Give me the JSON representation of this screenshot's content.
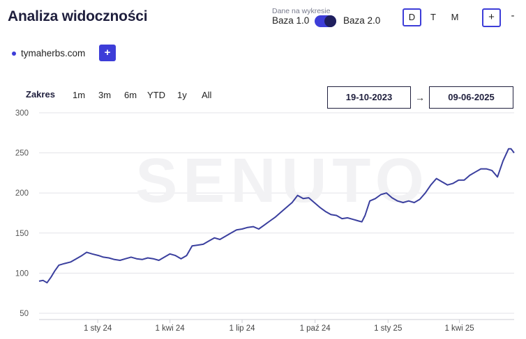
{
  "header": {
    "title": "Analiza widoczności"
  },
  "data_toggle": {
    "caption": "Dane na wykresie",
    "left_label": "Baza 1.0",
    "right_label": "Baza 2.0"
  },
  "granularity": {
    "options": [
      "D",
      "T",
      "M"
    ],
    "active": "D"
  },
  "zoom": {
    "in_label": "+",
    "out_label": "-"
  },
  "domain": {
    "name": "tymaherbs.com",
    "add_label": "+"
  },
  "range": {
    "label": "Zakres",
    "options": [
      "1m",
      "3m",
      "6m",
      "YTD",
      "1y",
      "All"
    ],
    "date_from": "19-10-2023",
    "arrow": "→",
    "date_to": "09-06-2025"
  },
  "watermark": "SENUTO",
  "colors": {
    "accent": "#3d3dd8",
    "line": "#3a3f9e",
    "text_dark": "#1f1f3d"
  },
  "chart_data": {
    "type": "line",
    "title": "",
    "xlabel": "",
    "ylabel": "",
    "ylim": [
      50,
      300
    ],
    "yticks": [
      50,
      100,
      150,
      200,
      250,
      300
    ],
    "xlim": [
      "2023-10-19",
      "2025-06-09"
    ],
    "xticks": [
      {
        "date": "2024-01-01",
        "label": "1 sty 24"
      },
      {
        "date": "2024-04-01",
        "label": "1 kwi 24"
      },
      {
        "date": "2024-07-01",
        "label": "1 lip 24"
      },
      {
        "date": "2024-10-01",
        "label": "1 paź 24"
      },
      {
        "date": "2025-01-01",
        "label": "1 sty 25"
      },
      {
        "date": "2025-04-01",
        "label": "1 kwi 25"
      }
    ],
    "grid": "horizontal",
    "series": [
      {
        "values": [
          [
            "2023-10-19",
            90
          ],
          [
            "2023-10-24",
            91
          ],
          [
            "2023-10-29",
            88
          ],
          [
            "2023-11-03",
            95
          ],
          [
            "2023-11-08",
            103
          ],
          [
            "2023-11-13",
            110
          ],
          [
            "2023-11-20",
            112
          ],
          [
            "2023-11-28",
            114
          ],
          [
            "2023-12-05",
            118
          ],
          [
            "2023-12-12",
            122
          ],
          [
            "2023-12-18",
            126
          ],
          [
            "2023-12-25",
            124
          ],
          [
            "2024-01-02",
            122
          ],
          [
            "2024-01-08",
            120
          ],
          [
            "2024-01-15",
            119
          ],
          [
            "2024-01-22",
            117
          ],
          [
            "2024-01-29",
            116
          ],
          [
            "2024-02-05",
            118
          ],
          [
            "2024-02-12",
            120
          ],
          [
            "2024-02-19",
            118
          ],
          [
            "2024-02-26",
            117
          ],
          [
            "2024-03-04",
            119
          ],
          [
            "2024-03-11",
            118
          ],
          [
            "2024-03-18",
            116
          ],
          [
            "2024-03-25",
            120
          ],
          [
            "2024-04-01",
            124
          ],
          [
            "2024-04-08",
            122
          ],
          [
            "2024-04-15",
            118
          ],
          [
            "2024-04-22",
            122
          ],
          [
            "2024-04-29",
            134
          ],
          [
            "2024-05-06",
            135
          ],
          [
            "2024-05-13",
            136
          ],
          [
            "2024-05-20",
            140
          ],
          [
            "2024-05-27",
            144
          ],
          [
            "2024-06-03",
            142
          ],
          [
            "2024-06-10",
            146
          ],
          [
            "2024-06-17",
            150
          ],
          [
            "2024-06-24",
            154
          ],
          [
            "2024-07-01",
            155
          ],
          [
            "2024-07-08",
            157
          ],
          [
            "2024-07-15",
            158
          ],
          [
            "2024-07-22",
            155
          ],
          [
            "2024-07-29",
            160
          ],
          [
            "2024-08-05",
            165
          ],
          [
            "2024-08-12",
            170
          ],
          [
            "2024-08-19",
            176
          ],
          [
            "2024-08-26",
            182
          ],
          [
            "2024-09-02",
            188
          ],
          [
            "2024-09-09",
            197
          ],
          [
            "2024-09-16",
            193
          ],
          [
            "2024-09-23",
            194
          ],
          [
            "2024-09-30",
            188
          ],
          [
            "2024-10-07",
            182
          ],
          [
            "2024-10-14",
            177
          ],
          [
            "2024-10-21",
            173
          ],
          [
            "2024-10-28",
            172
          ],
          [
            "2024-11-04",
            168
          ],
          [
            "2024-11-11",
            169
          ],
          [
            "2024-11-18",
            167
          ],
          [
            "2024-11-25",
            165
          ],
          [
            "2024-11-29",
            164
          ],
          [
            "2024-12-03",
            172
          ],
          [
            "2024-12-09",
            190
          ],
          [
            "2024-12-16",
            193
          ],
          [
            "2024-12-23",
            198
          ],
          [
            "2024-12-30",
            200
          ],
          [
            "2025-01-06",
            194
          ],
          [
            "2025-01-13",
            190
          ],
          [
            "2025-01-20",
            188
          ],
          [
            "2025-01-27",
            190
          ],
          [
            "2025-02-03",
            188
          ],
          [
            "2025-02-10",
            192
          ],
          [
            "2025-02-17",
            200
          ],
          [
            "2025-02-24",
            210
          ],
          [
            "2025-03-03",
            218
          ],
          [
            "2025-03-10",
            214
          ],
          [
            "2025-03-17",
            210
          ],
          [
            "2025-03-24",
            212
          ],
          [
            "2025-03-31",
            216
          ],
          [
            "2025-04-07",
            216
          ],
          [
            "2025-04-14",
            222
          ],
          [
            "2025-04-21",
            226
          ],
          [
            "2025-04-28",
            230
          ],
          [
            "2025-05-05",
            230
          ],
          [
            "2025-05-12",
            228
          ],
          [
            "2025-05-19",
            220
          ],
          [
            "2025-05-26",
            240
          ],
          [
            "2025-06-02",
            255
          ],
          [
            "2025-06-05",
            255
          ],
          [
            "2025-06-09",
            250
          ]
        ]
      }
    ]
  }
}
